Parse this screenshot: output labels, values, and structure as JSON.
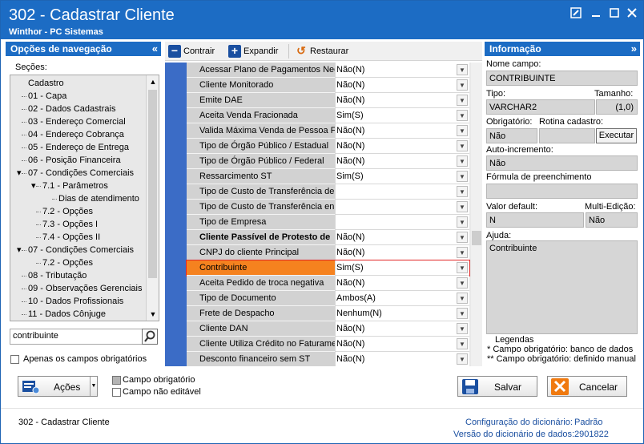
{
  "window": {
    "title": "302 - Cadastrar Cliente",
    "subtitle": "Winthor - PC Sistemas"
  },
  "nav": {
    "header": "Opções de navegação",
    "sections_label": "Seções:",
    "tree": [
      {
        "label": "Cadastro",
        "level": 0
      },
      {
        "label": "01 - Capa",
        "level": 1
      },
      {
        "label": "02 - Dados Cadastrais",
        "level": 1
      },
      {
        "label": "03 - Endereço Comercial",
        "level": 1
      },
      {
        "label": "04 - Endereço Cobrança",
        "level": 1
      },
      {
        "label": "05 - Endereço de Entrega",
        "level": 1
      },
      {
        "label": "06 - Posição Financeira",
        "level": 1
      },
      {
        "label": "07 - Condições Comerciais",
        "level": 1,
        "expanded": true
      },
      {
        "label": "7.1 - Parâmetros",
        "level": 2,
        "expanded": true
      },
      {
        "label": "Dias de atendimento",
        "level": 3
      },
      {
        "label": "7.2 - Opções",
        "level": 2
      },
      {
        "label": "7.3 - Opções I",
        "level": 2
      },
      {
        "label": "7.4 - Opções II",
        "level": 2
      },
      {
        "label": "07 - Condições Comerciais",
        "level": 1,
        "expanded": true
      },
      {
        "label": "7.2 - Opções",
        "level": 2
      },
      {
        "label": "08 - Tributação",
        "level": 1
      },
      {
        "label": "09 - Observações Gerenciais",
        "level": 1
      },
      {
        "label": "10 - Dados Profissionais",
        "level": 1
      },
      {
        "label": "11 - Dados Cônjuge",
        "level": 1
      }
    ],
    "search_value": "contribuinte",
    "only_required_label": "Apenas os campos obrigatórios"
  },
  "toolbar": {
    "collapse_label": "Contrair",
    "expand_label": "Expandir",
    "restore_label": "Restaurar"
  },
  "grid": {
    "rows": [
      {
        "label": "Acessar Plano de Pagamentos Negociado",
        "value": "Não(N)"
      },
      {
        "label": "Cliente Monitorado",
        "value": "Não(N)"
      },
      {
        "label": "Emite DAE",
        "value": "Não(N)"
      },
      {
        "label": "Aceita Venda Fracionada",
        "value": "Sim(S)"
      },
      {
        "label": "Valida Máxima Venda de Pessoa Física",
        "value": "Não(N)"
      },
      {
        "label": "Tipo de Órgão Público / Estadual",
        "value": "Não(N)"
      },
      {
        "label": "Tipo de Órgão Público / Federal",
        "value": "Não(N)"
      },
      {
        "label": "Ressarcimento ST",
        "value": "Sim(S)"
      },
      {
        "label": "Tipo de Custo de Transferência de",
        "value": ""
      },
      {
        "label": "Tipo de Custo de Transferência en",
        "value": ""
      },
      {
        "label": "Tipo de Empresa",
        "value": ""
      },
      {
        "label": "Cliente Passível de Protesto de",
        "value": "Não(N)",
        "bold": true
      },
      {
        "label": "CNPJ do cliente Principal",
        "value": "Não(N)"
      },
      {
        "label": "Contribuinte",
        "value": "Sim(S)",
        "selected": true
      },
      {
        "label": "Aceita Pedido de troca negativa",
        "value": "Não(N)"
      },
      {
        "label": "Tipo de Documento",
        "value": "Ambos(A)"
      },
      {
        "label": "Frete de Despacho",
        "value": "Nenhum(N)"
      },
      {
        "label": "Cliente DAN",
        "value": "Não(N)"
      },
      {
        "label": "Cliente Utiliza Crédito no Faturamento",
        "value": "Não(N)"
      },
      {
        "label": "Desconto financeiro sem ST",
        "value": "Não(N)"
      }
    ]
  },
  "info": {
    "header": "Informação",
    "field_name_label": "Nome campo:",
    "field_name": "CONTRIBUINTE",
    "type_label": "Tipo:",
    "type": "VARCHAR2",
    "size_label": "Tamanho:",
    "size": "(1,0)",
    "required_label": "Obrigatório:",
    "required": "Não",
    "routine_label": "Rotina cadastro:",
    "execute_label": "Executar",
    "autoinc_label": "Auto-incremento:",
    "autoinc": "Não",
    "formula_label": "Fórmula de preenchimento",
    "formula": "",
    "default_label": "Valor default:",
    "default": "N",
    "multiedit_label": "Multi-Edição:",
    "multiedit": "Não",
    "help_label": "Ajuda:",
    "help": "Contribuinte",
    "legend_title": "Legendas",
    "legend_1": "* Campo obrigatório: banco de dados",
    "legend_2": "** Campo obrigatório: definido manual"
  },
  "bottom": {
    "actions_label": "Ações",
    "legend_required": "Campo obrigatório",
    "legend_readonly": "Campo não editável",
    "save_label": "Salvar",
    "cancel_label": "Cancelar"
  },
  "footer": {
    "routine": "302 - Cadastrar Cliente",
    "dict_config_label": "Configuração do dicionário:",
    "dict_config": "Padrão",
    "dict_version_label": "Versão do dicionário de dados:",
    "dict_version": "2901822"
  },
  "colors": {
    "title_bar": "#1c6cc4",
    "selected_row": "#f5821f",
    "selected_outline": "#e22626",
    "grid_strip": "#3b6cc6"
  }
}
